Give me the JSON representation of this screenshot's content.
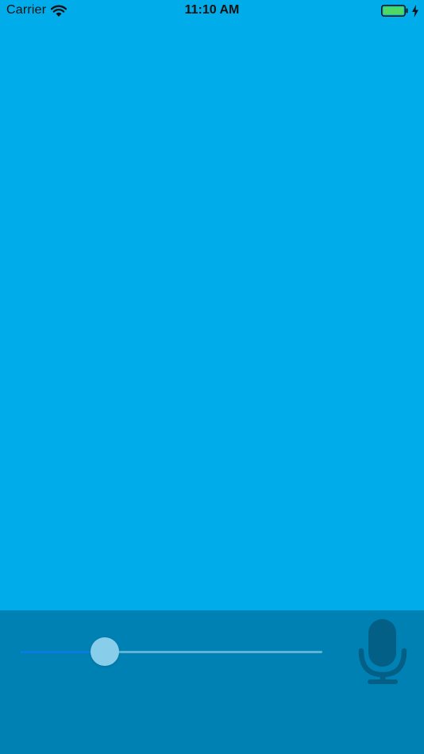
{
  "status_bar": {
    "carrier": "Carrier",
    "time": "11:10 AM",
    "battery_color": "#4cd964"
  },
  "colors": {
    "content_background": "#00adea",
    "panel_background": "#0081b4",
    "slider_fill": "#0a7ce0",
    "slider_track": "#5fb3d6",
    "slider_thumb": "#88cdea",
    "mic_icon": "#045f87"
  },
  "controls": {
    "slider_value": 0.28,
    "mic_icon": "microphone-icon"
  }
}
